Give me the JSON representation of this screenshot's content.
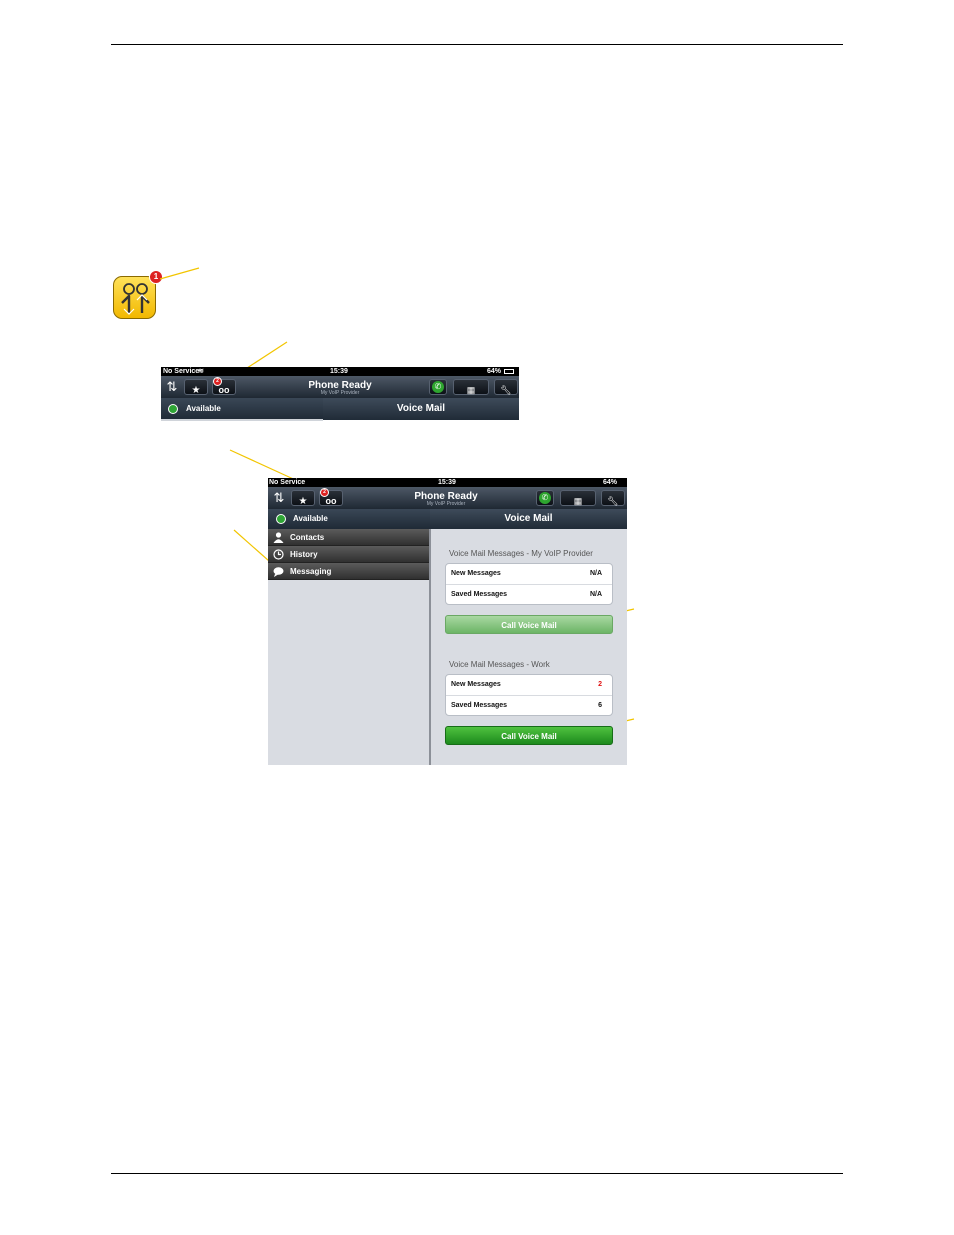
{
  "app_icon": {
    "badge": "1",
    "colors": {
      "face": "#f5c518"
    }
  },
  "small_screen": {
    "status": {
      "carrier": "No Service",
      "time": "15:39",
      "battery": "64%"
    },
    "nav": {
      "title": "Phone Ready",
      "subtitle": "My VoIP Provider",
      "vm_badge": "2",
      "icons": [
        "contacts-icon",
        "star-icon",
        "voicemail-icon",
        "call-icon",
        "keypad-icon",
        "wrench-icon"
      ]
    },
    "presence": "Available",
    "header": "Voice Mail"
  },
  "large_screen": {
    "status": {
      "carrier": "No Service",
      "time": "15:39",
      "battery": "64%"
    },
    "nav": {
      "title": "Phone Ready",
      "subtitle": "My VoIP Provider",
      "vm_badge": "2"
    },
    "presence": "Available",
    "header": "Voice Mail",
    "menu": [
      {
        "label": "Contacts",
        "icon": "person-icon"
      },
      {
        "label": "History",
        "icon": "clock-icon"
      },
      {
        "label": "Messaging",
        "icon": "chat-bubble-icon"
      }
    ],
    "sections": [
      {
        "title": "Voice Mail Messages - My VoIP Provider",
        "rows": [
          {
            "label": "New Messages",
            "value": "N/A"
          },
          {
            "label": "Saved Messages",
            "value": "N/A"
          }
        ],
        "button": "Call Voice Mail"
      },
      {
        "title": "Voice Mail Messages - Work",
        "rows": [
          {
            "label": "New Messages",
            "value": "2"
          },
          {
            "label": "Saved Messages",
            "value": "6"
          }
        ],
        "button": "Call Voice Mail"
      }
    ]
  },
  "colors": {
    "callout": "#f2c500",
    "accent_green": "#2ea52f",
    "new_count": "#e01010"
  }
}
